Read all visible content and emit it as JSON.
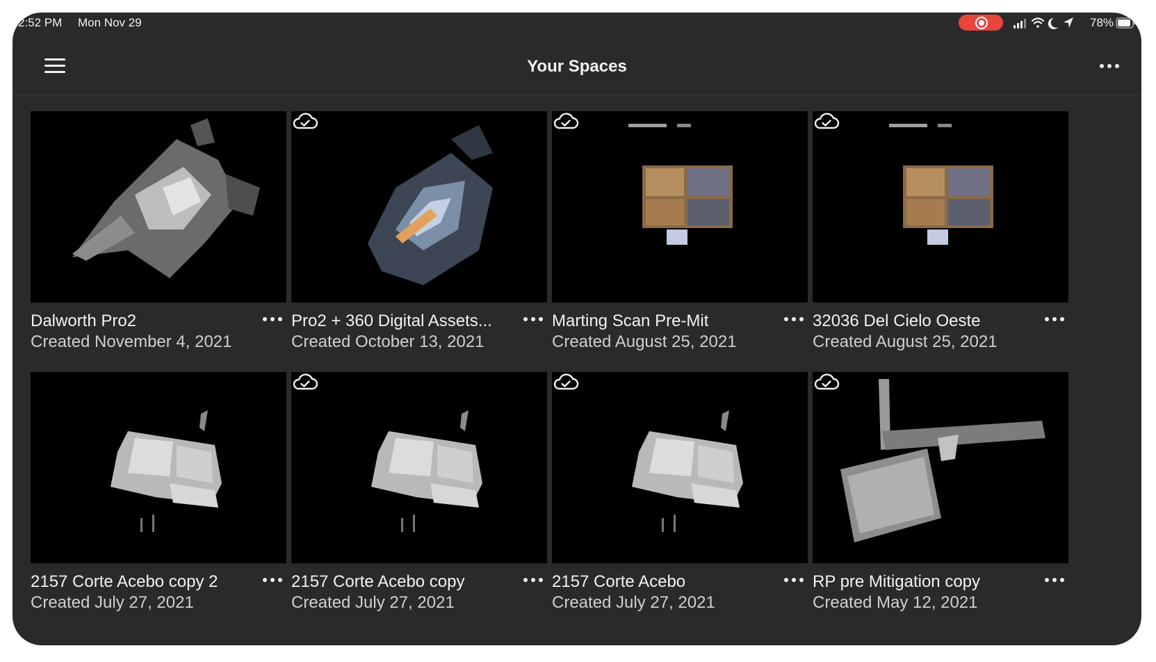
{
  "status_bar": {
    "time": "2:52 PM",
    "date": "Mon Nov 29",
    "battery": "78%",
    "icons": [
      "screen-record-icon",
      "cellular-signal-icon",
      "wifi-icon",
      "do-not-disturb-moon-icon",
      "location-arrow-icon",
      "battery-icon"
    ]
  },
  "nav": {
    "title": "Your Spaces",
    "menu_icon": "hamburger-menu-icon",
    "more_icon": "more-options-icon"
  },
  "spaces": [
    {
      "title": "Dalworth Pro2",
      "created": "Created November 4, 2021",
      "cloud_synced": false,
      "preview": "pointcloud-gray"
    },
    {
      "title": "Pro2 + 360 Digital Assets...",
      "created": "Created October 13, 2021",
      "cloud_synced": true,
      "preview": "pointcloud-blue"
    },
    {
      "title": "Marting Scan Pre-Mit",
      "created": "Created August 25, 2021",
      "cloud_synced": true,
      "preview": "floorplan-color"
    },
    {
      "title": "32036 Del Cielo Oeste",
      "created": "Created August 25, 2021",
      "cloud_synced": true,
      "preview": "floorplan-color"
    },
    {
      "title": "2157 Corte Acebo copy 2",
      "created": "Created July 27, 2021",
      "cloud_synced": false,
      "preview": "floorplan-white"
    },
    {
      "title": "2157 Corte Acebo copy",
      "created": "Created July 27, 2021",
      "cloud_synced": true,
      "preview": "floorplan-white"
    },
    {
      "title": "2157 Corte Acebo",
      "created": "Created July 27, 2021",
      "cloud_synced": true,
      "preview": "floorplan-white"
    },
    {
      "title": "RP pre Mitigation copy",
      "created": "Created May 12, 2021",
      "cloud_synced": true,
      "preview": "pointcloud-warehouse"
    }
  ]
}
